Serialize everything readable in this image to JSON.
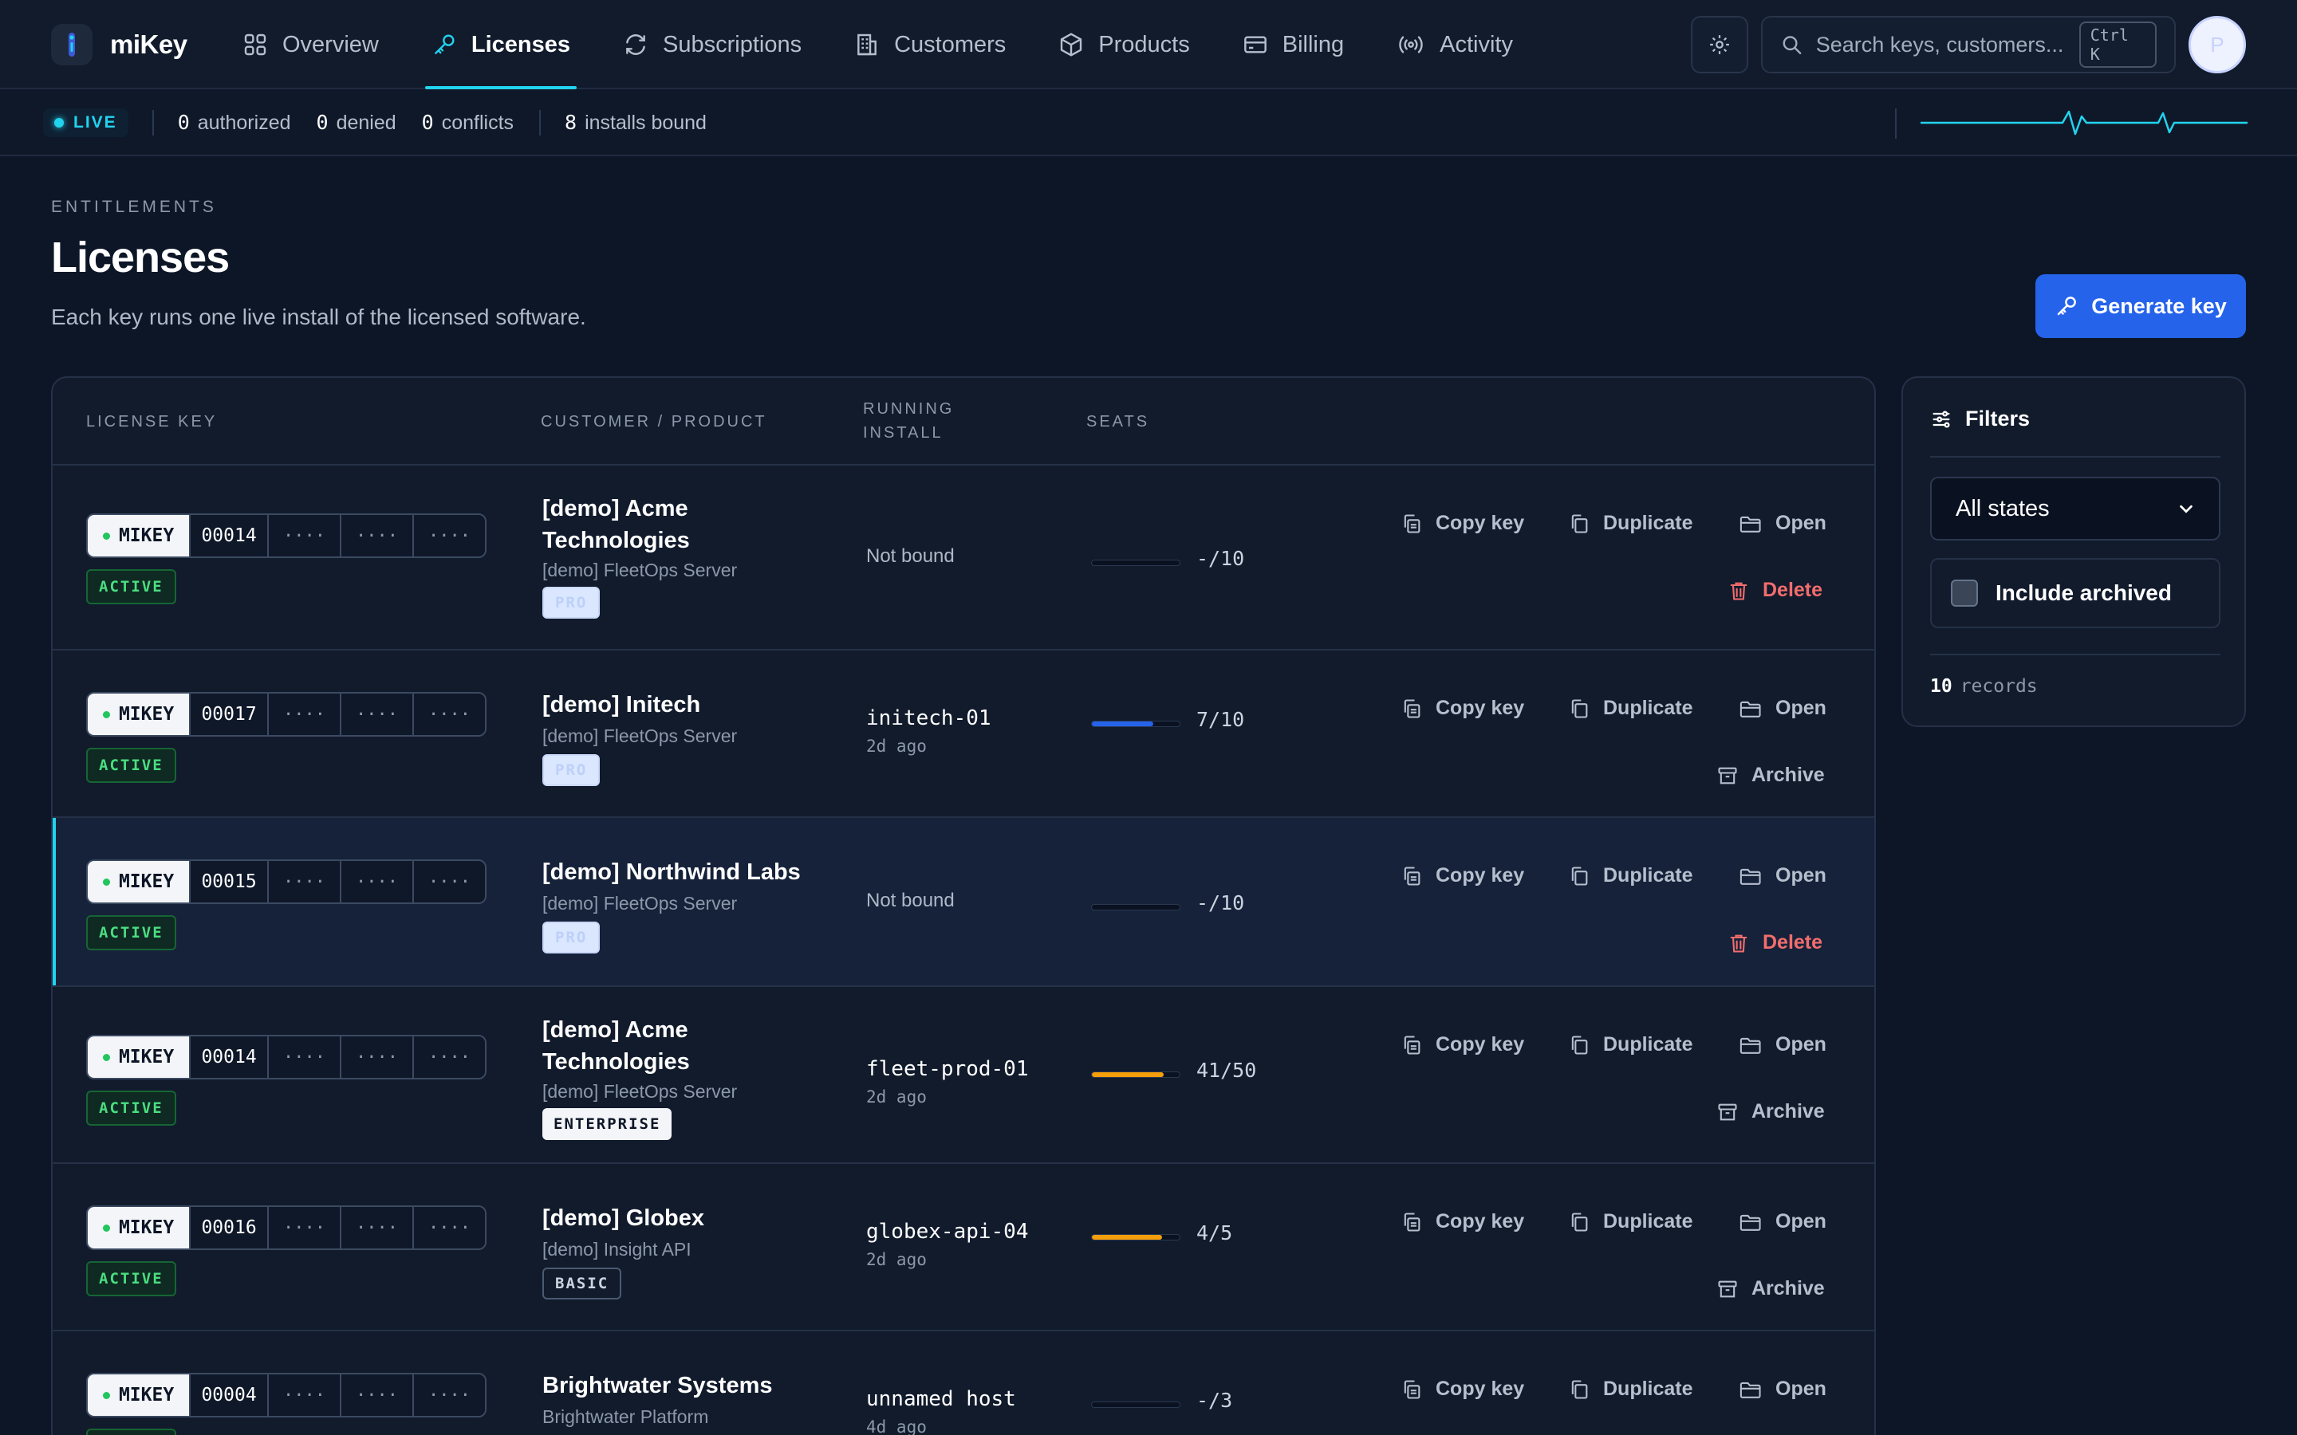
{
  "app": {
    "name": "miKey"
  },
  "nav": {
    "tabs": [
      {
        "label": "Overview",
        "icon": "grid-icon"
      },
      {
        "label": "Licenses",
        "icon": "key-icon",
        "active": true
      },
      {
        "label": "Subscriptions",
        "icon": "refresh-icon"
      },
      {
        "label": "Customers",
        "icon": "building-icon"
      },
      {
        "label": "Products",
        "icon": "box-icon"
      },
      {
        "label": "Billing",
        "icon": "card-icon"
      },
      {
        "label": "Activity",
        "icon": "signal-icon"
      }
    ],
    "search_placeholder": "Search keys, customers...",
    "search_shortcut": "Ctrl K",
    "avatar_initial": "P"
  },
  "status": {
    "live_label": "LIVE",
    "authorized": {
      "num": "0",
      "label": "authorized"
    },
    "denied": {
      "num": "0",
      "label": "denied"
    },
    "conflicts": {
      "num": "0",
      "label": "conflicts"
    },
    "installs": {
      "num": "8",
      "label": "installs bound"
    }
  },
  "header": {
    "eyebrow": "ENTITLEMENTS",
    "title": "Licenses",
    "subtitle": "Each key runs one live install of the licensed software.",
    "generate_label": "Generate key"
  },
  "table": {
    "columns": {
      "key": "LICENSE KEY",
      "customer": "CUSTOMER / PRODUCT",
      "install_1": "RUNNING",
      "install_2": "INSTALL",
      "seats": "SEATS"
    },
    "key_prefix": "MIKEY",
    "masked": "····",
    "actions": {
      "copy": "Copy key",
      "duplicate": "Duplicate",
      "open": "Open",
      "delete": "Delete",
      "archive": "Archive"
    },
    "rows": [
      {
        "key_id": "00014",
        "state": "ACTIVE",
        "customer_1": "[demo] Acme",
        "customer_2": "Technologies",
        "product": "[demo] FleetOps Server",
        "tier": "PRO",
        "install": "Not bound",
        "seats": "-/10",
        "seats_frac": 0,
        "seat_color": "#2563eb",
        "secondary": "delete"
      },
      {
        "key_id": "00017",
        "state": "ACTIVE",
        "customer_1": "[demo] Initech",
        "customer_2": "",
        "product": "[demo] FleetOps Server",
        "tier": "PRO",
        "install": "initech-01",
        "install_time": "2d ago",
        "seats": "7/10",
        "seats_frac": 0.7,
        "seat_color": "#2563eb",
        "secondary": "archive"
      },
      {
        "key_id": "00015",
        "state": "ACTIVE",
        "customer_1": "[demo] Northwind Labs",
        "customer_2": "",
        "product": "[demo] FleetOps Server",
        "tier": "PRO",
        "install": "Not bound",
        "seats": "-/10",
        "seats_frac": 0,
        "seat_color": "#2563eb",
        "secondary": "delete",
        "selected": true
      },
      {
        "key_id": "00014",
        "state": "ACTIVE",
        "customer_1": "[demo] Acme",
        "customer_2": "Technologies",
        "product": "[demo] FleetOps Server",
        "tier": "ENTERPRISE",
        "install": "fleet-prod-01",
        "install_time": "2d ago",
        "seats": "41/50",
        "seats_frac": 0.82,
        "seat_color": "#f59e0b",
        "secondary": "archive"
      },
      {
        "key_id": "00016",
        "state": "ACTIVE",
        "customer_1": "[demo] Globex",
        "customer_2": "",
        "product": "[demo] Insight API",
        "tier": "BASIC",
        "install": "globex-api-04",
        "install_time": "2d ago",
        "seats": "4/5",
        "seats_frac": 0.8,
        "seat_color": "#f59e0b",
        "secondary": "archive"
      },
      {
        "key_id": "00004",
        "state": "ACTIVE",
        "customer_1": "Brightwater Systems",
        "customer_2": "",
        "product": "Brightwater Platform",
        "tier": "",
        "install": "unnamed host",
        "install_time": "4d ago",
        "seats": "-/3",
        "seats_frac": 0,
        "seat_color": "#2563eb",
        "secondary": ""
      }
    ]
  },
  "filters": {
    "title": "Filters",
    "state_select": "All states",
    "include_archived": "Include archived",
    "records_num": "10",
    "records_label": "records"
  },
  "colors": {
    "accent": "#22d3ee",
    "primary": "#2563eb",
    "active_green": "#4ade80",
    "danger": "#f26d6d",
    "warning": "#f59e0b"
  }
}
